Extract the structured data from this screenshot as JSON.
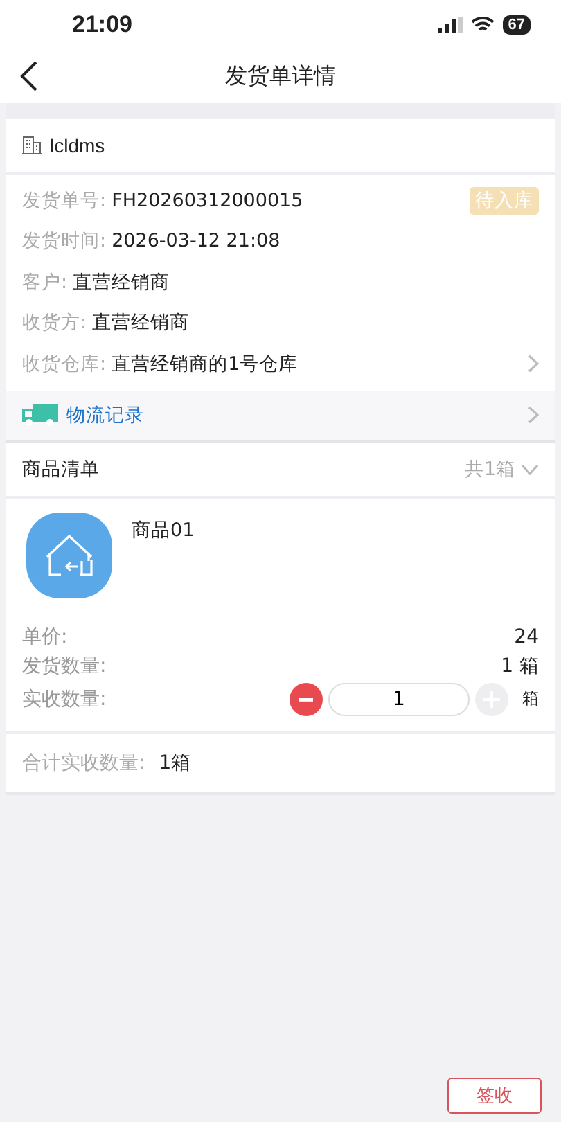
{
  "status_bar": {
    "time": "21:09",
    "battery": "67"
  },
  "nav": {
    "title": "发货单详情"
  },
  "company": {
    "name": "lcldms"
  },
  "info": {
    "status_badge": "待入库",
    "rows": [
      {
        "label": "发货单号:",
        "value": "FH20260312000015",
        "link": false
      },
      {
        "label": "发货时间:",
        "value": "2026-03-12 21:08",
        "link": false
      },
      {
        "label": "客户:",
        "value": "直营经销商",
        "link": false
      },
      {
        "label": "收货方:",
        "value": "直营经销商",
        "link": false
      },
      {
        "label": "收货仓库:",
        "value": "直营经销商的1号仓库",
        "link": true
      }
    ]
  },
  "logistics": {
    "label": "物流记录"
  },
  "goods": {
    "title": "商品清单",
    "count": "共1箱",
    "expanded": true,
    "items": [
      {
        "name": "商品01",
        "price_label": "单价:",
        "price": "24",
        "shipped_label": "发货数量:",
        "shipped": "1 箱",
        "received_label": "实收数量:",
        "received": "1",
        "unit": "箱",
        "minus_disabled": false,
        "plus_disabled": true
      }
    ]
  },
  "total": {
    "label": "合计实收数量:",
    "value": "1箱"
  },
  "footer": {
    "button": "签收"
  }
}
